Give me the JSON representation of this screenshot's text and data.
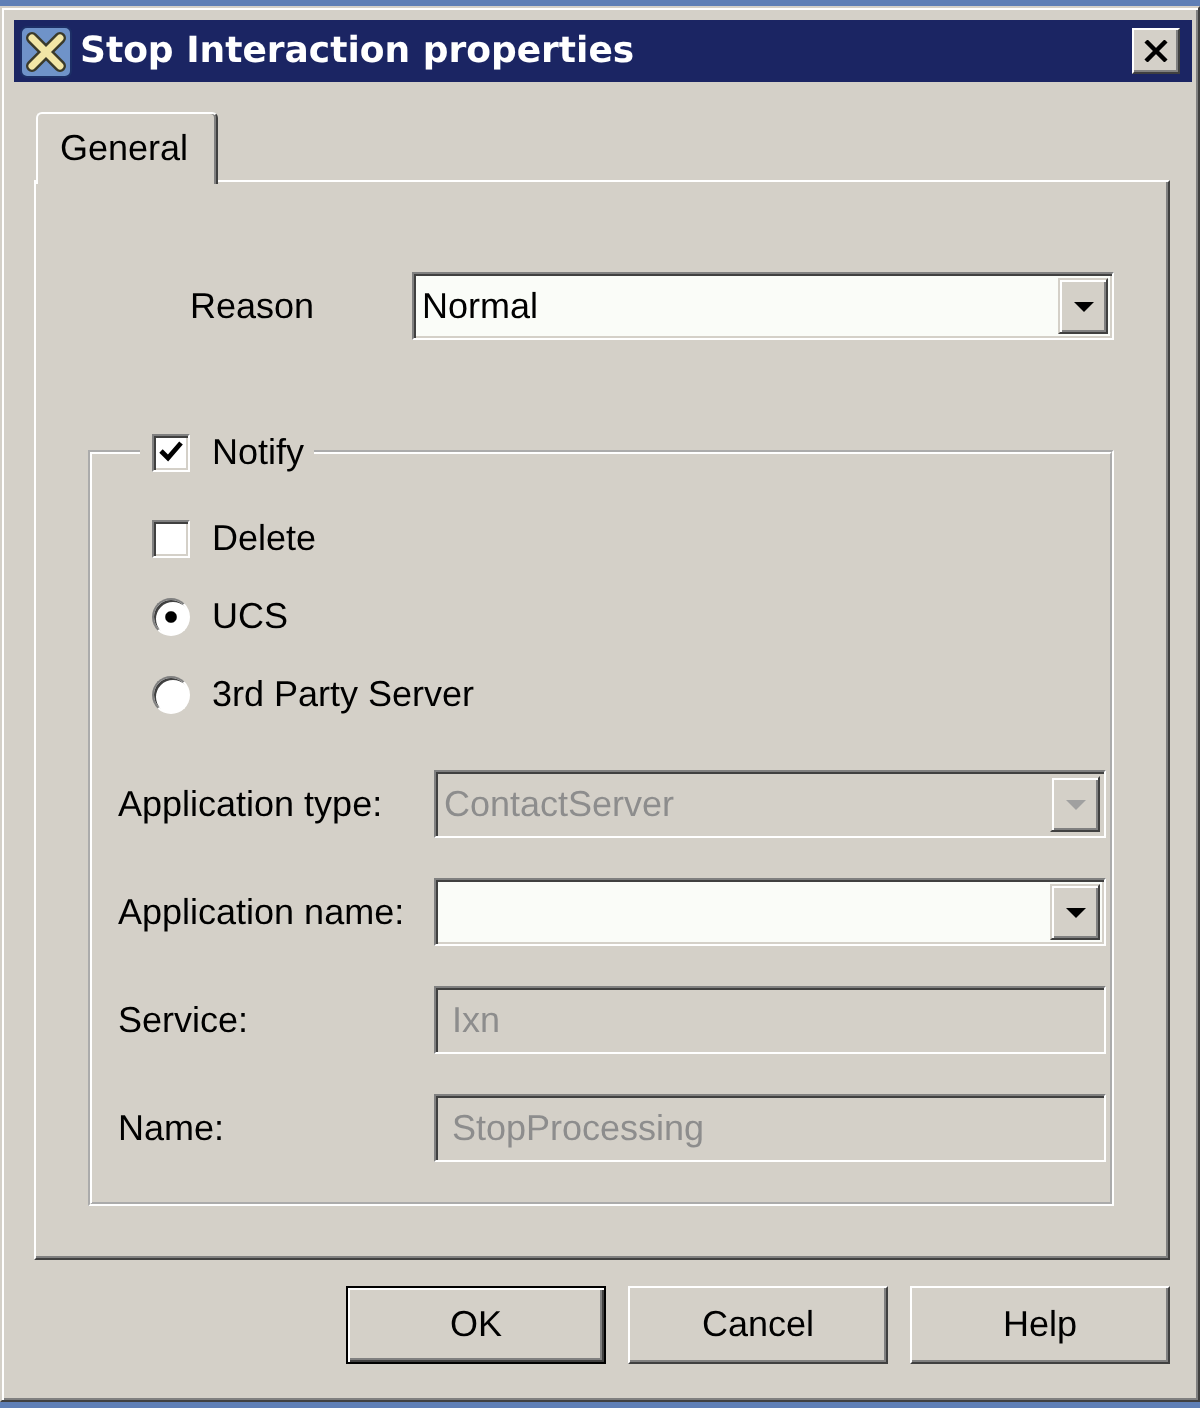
{
  "window": {
    "title": "Stop Interaction properties"
  },
  "tabs": [
    {
      "label": "General",
      "selected": true
    }
  ],
  "reason": {
    "label": "Reason",
    "value": "Normal"
  },
  "notify_group": {
    "notify": {
      "label": "Notify",
      "checked": true
    },
    "options": [
      {
        "kind": "checkbox",
        "label": "Delete",
        "checked": false
      },
      {
        "kind": "radio",
        "label": "UCS",
        "selected": true
      },
      {
        "kind": "radio",
        "label": "3rd Party Server",
        "selected": false
      }
    ],
    "fields": [
      {
        "kind": "dropdown",
        "label": "Application type:",
        "value": "ContactServer",
        "disabled": true
      },
      {
        "kind": "dropdown",
        "label": "Application name:",
        "disabled": false
      },
      {
        "kind": "text",
        "label": "Service:",
        "value": "Ixn",
        "disabled": true
      },
      {
        "kind": "text",
        "label": "Name:",
        "value": "StopProcessing",
        "disabled": true
      }
    ]
  },
  "buttons": [
    {
      "label": "OK",
      "default": true
    },
    {
      "label": "Cancel",
      "default": false
    },
    {
      "label": "Help",
      "default": false
    }
  ]
}
